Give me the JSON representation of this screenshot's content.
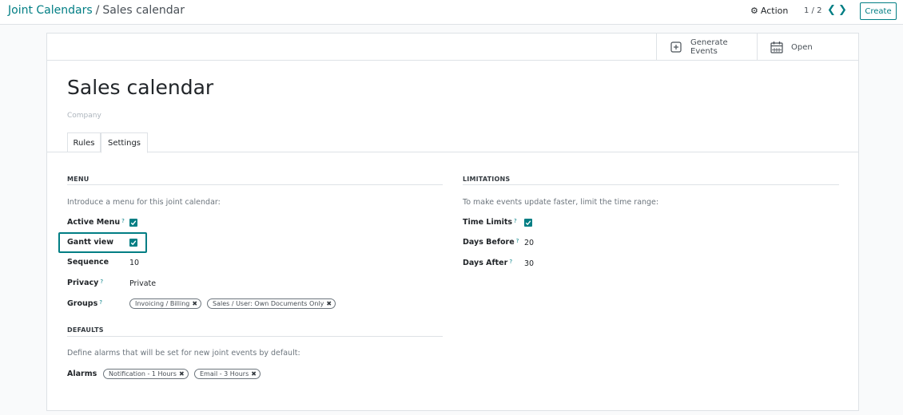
{
  "breadcrumb": {
    "parent": "Joint Calendars",
    "separator": "/",
    "current": "Sales calendar"
  },
  "toolbar": {
    "action_label": "Action",
    "pager": "1 / 2",
    "create_label": "Create"
  },
  "smart_buttons": {
    "generate_line1": "Generate",
    "generate_line2": "Events",
    "open_label": "Open"
  },
  "record": {
    "title": "Sales calendar",
    "company_placeholder": "Company"
  },
  "tabs": [
    {
      "label": "Rules"
    },
    {
      "label": "Settings"
    }
  ],
  "menu_section": {
    "title": "MENU",
    "hint": "Introduce a menu for this joint calendar:",
    "active_menu_label": "Active Menu",
    "gantt_view_label": "Gantt view",
    "sequence_label": "Sequence",
    "sequence_value": "10",
    "privacy_label": "Privacy",
    "privacy_value": "Private",
    "groups_label": "Groups",
    "groups": [
      "Invoicing / Billing",
      "Sales / User: Own Documents Only"
    ]
  },
  "defaults_section": {
    "title": "DEFAULTS",
    "hint": "Define alarms that will be set for new joint events by default:",
    "alarms_label": "Alarms",
    "alarms": [
      "Notification - 1 Hours",
      "Email - 3 Hours"
    ]
  },
  "limitations_section": {
    "title": "LIMITATIONS",
    "hint": "To make events update faster, limit the time range:",
    "time_limits_label": "Time Limits",
    "days_before_label": "Days Before",
    "days_before_value": "20",
    "days_after_label": "Days After",
    "days_after_value": "30"
  },
  "help_mark": "?",
  "colors": {
    "accent": "#017e84",
    "text": "#212529",
    "muted": "#6c757d",
    "border": "#dee2e6"
  }
}
